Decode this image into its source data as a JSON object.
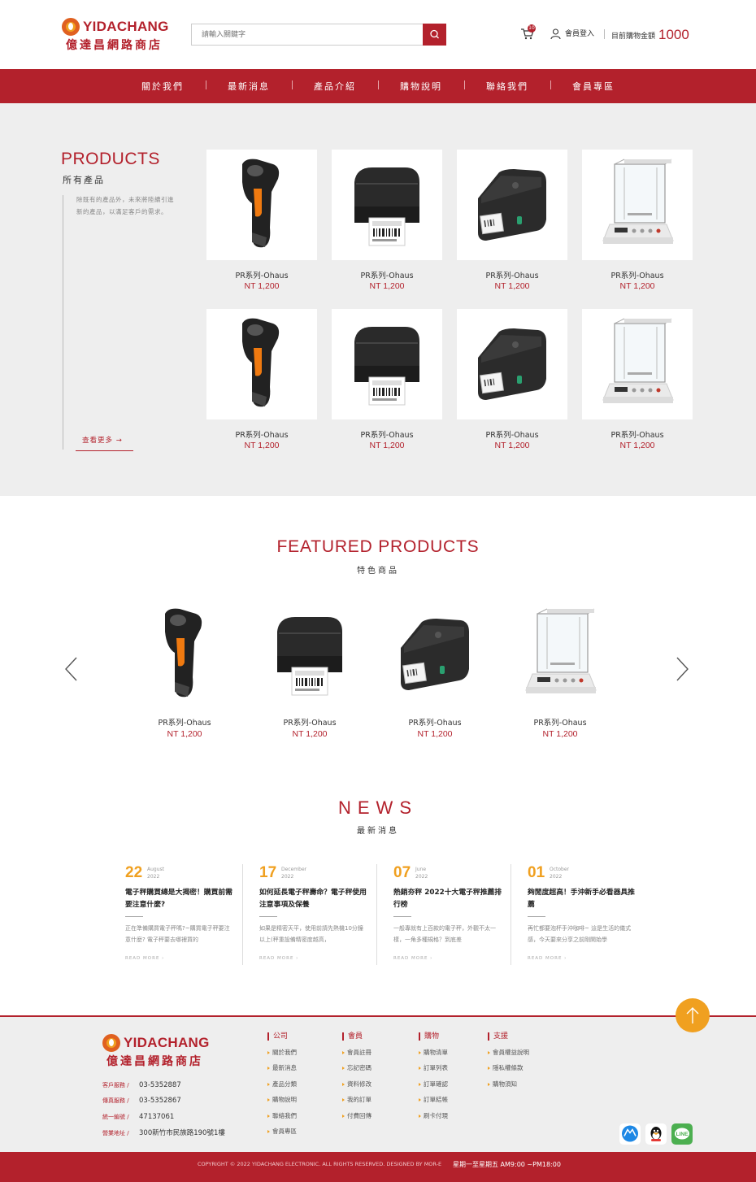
{
  "header": {
    "logo_en": "YIDACHANG",
    "logo_zh": "億達昌網路商店",
    "search_placeholder": "請輸入關鍵字",
    "cart_count": "10",
    "login_label": "會員登入",
    "total_label": "目前購物金額",
    "total_amount": "1000"
  },
  "nav": [
    "關於我們",
    "最新消息",
    "產品介紹",
    "購物說明",
    "聯絡我們",
    "會員專區"
  ],
  "products_section": {
    "title_en": "PRODUCTS",
    "title_zh": "所有產品",
    "description": "除既有的產品外，未來將陸續引進新的產品，以滿足客戶的需求。",
    "more_label": "查看更多 →",
    "items": [
      {
        "name": "PR系列-Ohaus",
        "price": "NT 1,200",
        "icon": "barcode-scanner"
      },
      {
        "name": "PR系列-Ohaus",
        "price": "NT 1,200",
        "icon": "label-printer"
      },
      {
        "name": "PR系列-Ohaus",
        "price": "NT 1,200",
        "icon": "desktop-printer"
      },
      {
        "name": "PR系列-Ohaus",
        "price": "NT 1,200",
        "icon": "analytical-balance"
      },
      {
        "name": "PR系列-Ohaus",
        "price": "NT 1,200",
        "icon": "barcode-scanner"
      },
      {
        "name": "PR系列-Ohaus",
        "price": "NT 1,200",
        "icon": "label-printer"
      },
      {
        "name": "PR系列-Ohaus",
        "price": "NT 1,200",
        "icon": "desktop-printer"
      },
      {
        "name": "PR系列-Ohaus",
        "price": "NT 1,200",
        "icon": "analytical-balance"
      }
    ]
  },
  "featured": {
    "title_en": "FEATURED PRODUCTS",
    "title_zh": "特色商品",
    "items": [
      {
        "name": "PR系列-Ohaus",
        "price": "NT 1,200",
        "icon": "barcode-scanner"
      },
      {
        "name": "PR系列-Ohaus",
        "price": "NT 1,200",
        "icon": "label-printer"
      },
      {
        "name": "PR系列-Ohaus",
        "price": "NT 1,200",
        "icon": "desktop-printer"
      },
      {
        "name": "PR系列-Ohaus",
        "price": "NT 1,200",
        "icon": "analytical-balance"
      }
    ]
  },
  "news": {
    "title_en": "NEWS",
    "title_zh": "最新消息",
    "read_more": "READ MORE  ›",
    "items": [
      {
        "day": "22",
        "month": "August",
        "year": "2022",
        "title": "電子秤購買總是大揭密！購買前需要注意什麼?",
        "excerpt": "正在準備購買電子秤嗎?~購買電子秤要注意什麼? 電子秤要去哪裡買的"
      },
      {
        "day": "17",
        "month": "December",
        "year": "2022",
        "title": "如何延長電子秤壽命？電子秤使用注意事項及保養",
        "excerpt": "如果是精密天平，使用前請先熱機10分鐘以上(秤重設備精密度越高，"
      },
      {
        "day": "07",
        "month": "June",
        "year": "2022",
        "title": "熱銷夯秤 2022十大電子秤推薦排行榜",
        "excerpt": "一般專就有上百款的電子秤，外觀不太一樣，一角多種規格？到底差"
      },
      {
        "day": "01",
        "month": "October",
        "year": "2022",
        "title": "夠閒度超高！手沖新手必看器具推薦",
        "excerpt": "再忙都要泡杯手沖咖啡~ 這是生活的儀式感，今天要來分享之前剛開始學"
      }
    ]
  },
  "footer": {
    "logo_en": "YIDACHANG",
    "logo_zh": "億達昌網路商店",
    "info": [
      {
        "label": "客戶服務 /",
        "value": "03-5352887"
      },
      {
        "label": "傳真服務 /",
        "value": "03-5352867"
      },
      {
        "label": "統一編號 /",
        "value": "47137061"
      },
      {
        "label": "營業地址 /",
        "value": "300新竹市民族路190號1樓"
      }
    ],
    "columns": [
      {
        "heading": "公司",
        "links": [
          "關於我們",
          "最新消息",
          "產品分類",
          "購物說明",
          "聯絡我們",
          "會員專區"
        ]
      },
      {
        "heading": "會員",
        "links": [
          "會員註冊",
          "忘記密碼",
          "資料修改",
          "我的訂單",
          "付費回傳"
        ]
      },
      {
        "heading": "購物",
        "links": [
          "購物清單",
          "訂單列表",
          "訂單確認",
          "訂單結帳",
          "刷卡付現"
        ]
      },
      {
        "heading": "支援",
        "links": [
          "會員權益說明",
          "隱私權條款",
          "購物須知"
        ]
      }
    ],
    "copyright": "COPYRIGHT © 2022  YIDACHANG ELECTRONIC. ALL RIGHTS RESERVED.  DESIGNED BY MOR-E",
    "hours": "星期一至星期五 AM9:00 ~PM18:00",
    "social": [
      "messenger-icon",
      "qq-icon",
      "line-icon"
    ],
    "social_labels": {
      "line": "LINE"
    }
  },
  "colors": {
    "brand": "#b3212c",
    "accent": "#f0a020"
  }
}
